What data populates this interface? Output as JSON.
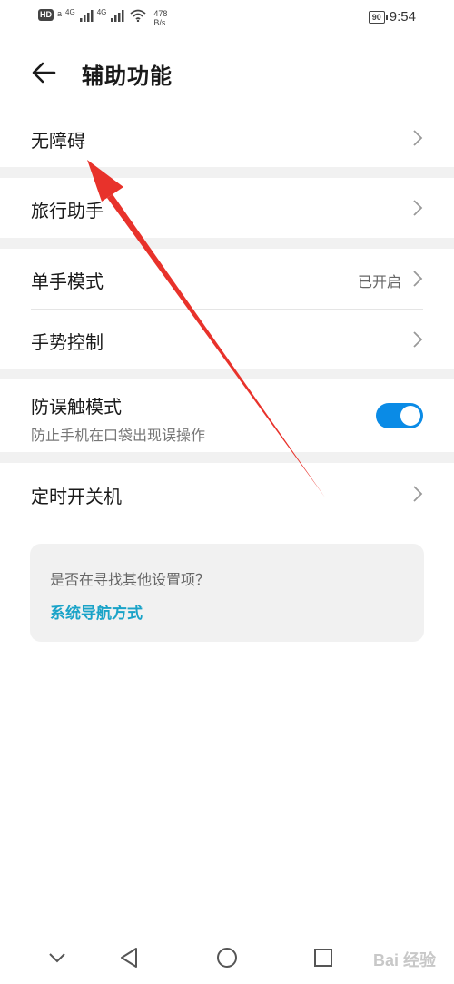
{
  "status_bar": {
    "hd1": "HD",
    "hd2": "a",
    "net1": "4G",
    "net2": "4G",
    "speed_value": "478",
    "speed_unit": "B/s",
    "battery": "90",
    "time": "9:54"
  },
  "header": {
    "title": "辅助功能"
  },
  "items": {
    "accessibility": "无障碍",
    "travel_assistant": "旅行助手",
    "one_hand_mode": "单手模式",
    "one_hand_value": "已开启",
    "gesture_control": "手势控制",
    "mistouch_mode": "防误触模式",
    "mistouch_desc": "防止手机在口袋出现误操作",
    "scheduled_power": "定时开关机"
  },
  "toggle_on": true,
  "suggestion": {
    "question": "是否在寻找其他设置项？",
    "link": "系统导航方式"
  },
  "colors": {
    "accent": "#0a8be6",
    "link": "#1aa3c8",
    "annotation_arrow": "#e8322b"
  },
  "watermark": "Bai 经验"
}
